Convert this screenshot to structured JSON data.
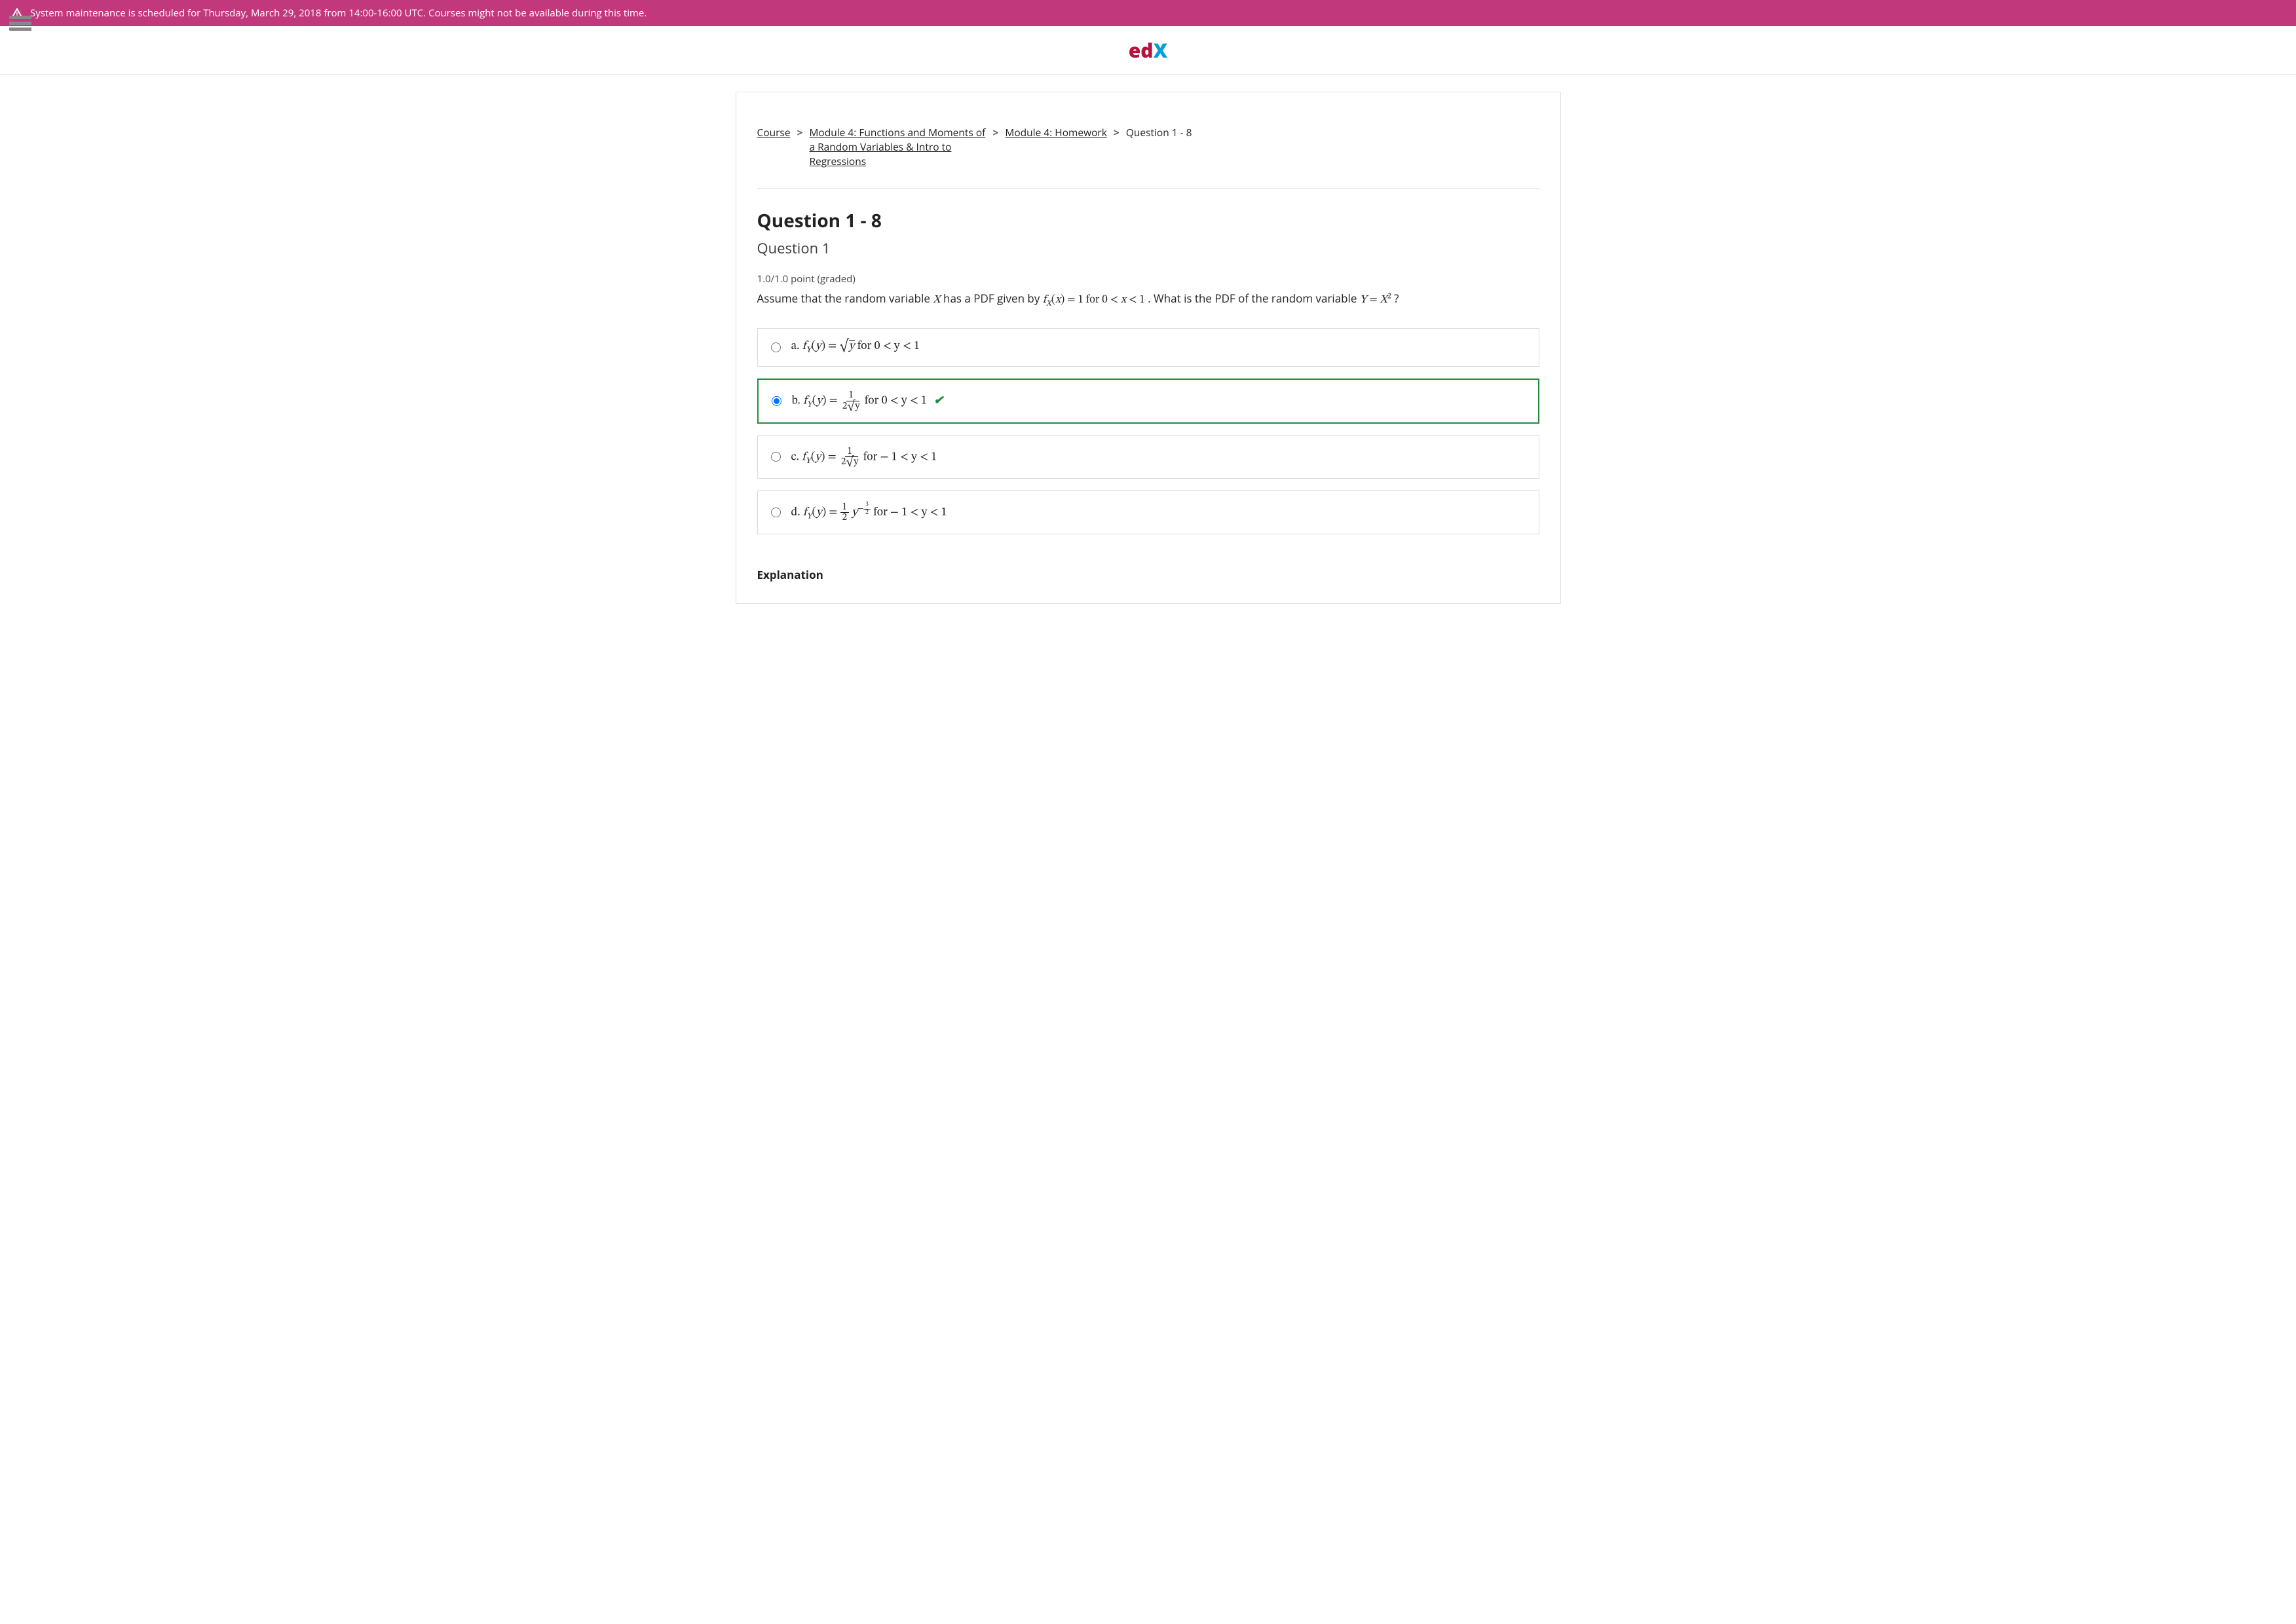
{
  "banner": {
    "text": "System maintenance is scheduled for Thursday, March 29, 2018 from 14:00-16:00 UTC. Courses might not be available during this time."
  },
  "logo": {
    "part1": "e",
    "part2": "d",
    "part3": "X"
  },
  "breadcrumb": {
    "course": "Course",
    "module": "Module 4: Functions and Moments of a Random Variables & Intro to Regressions",
    "homework": "Module 4: Homework",
    "current": "Question 1 - 8"
  },
  "page": {
    "heading": "Question 1 - 8",
    "subheading": "Question 1",
    "points": "1.0/1.0 point (graded)",
    "prompt_pre": "Assume that the random variable ",
    "prompt_mid1": " has a PDF given by ",
    "prompt_mid2": ". What is the PDF of the random variable ",
    "prompt_end": "?"
  },
  "choices": {
    "a": {
      "letter": "a.",
      "range": " for 0 < y < 1"
    },
    "b": {
      "letter": "b.",
      "range": " for 0 < y < 1"
    },
    "c": {
      "letter": "c.",
      "range": " for  − 1 < y < 1"
    },
    "d": {
      "letter": "d.",
      "range": " for  − 1 < y < 1"
    }
  },
  "explanation": {
    "heading": "Explanation"
  },
  "selected": "b",
  "correct": "b"
}
